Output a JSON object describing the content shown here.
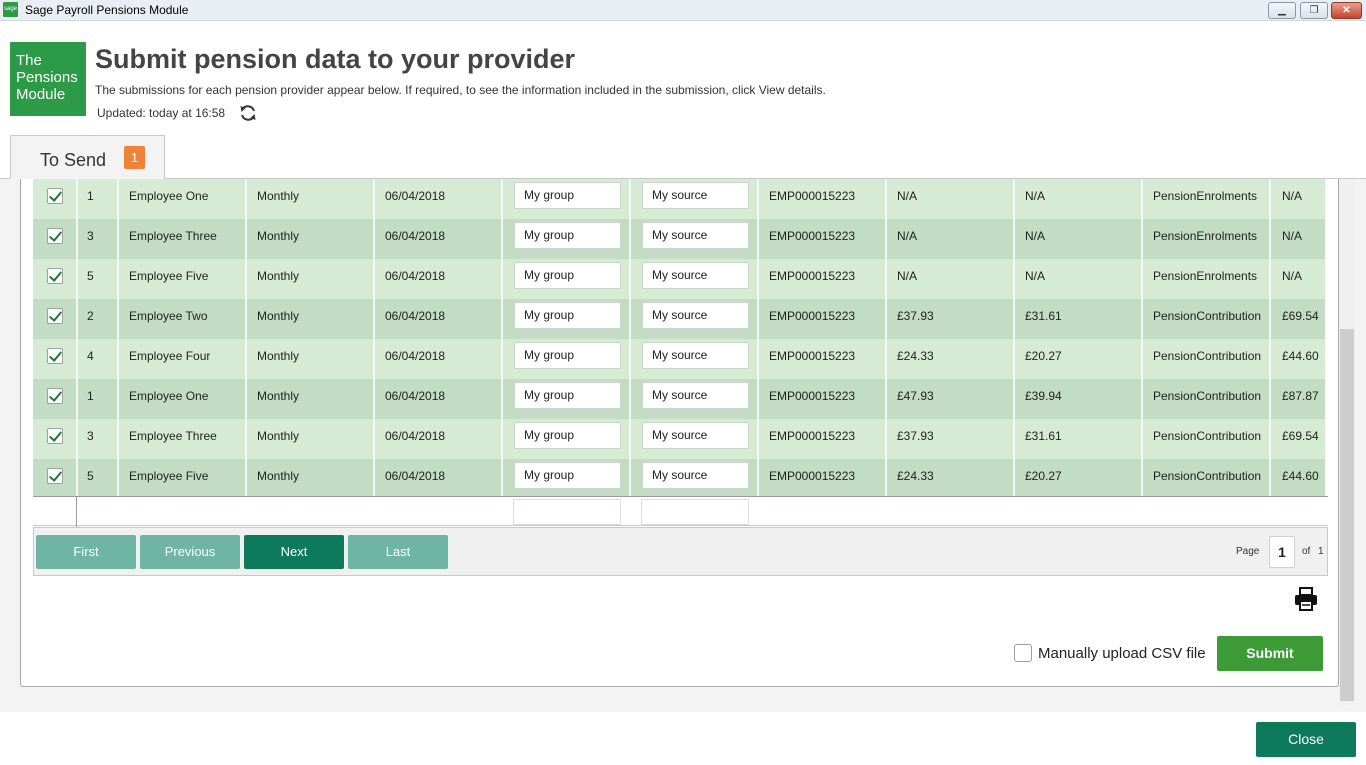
{
  "window": {
    "app_icon_text": "sage",
    "title": "Sage Payroll Pensions Module",
    "min_symbol": "▁",
    "max_symbol": "❐",
    "close_symbol": "✕"
  },
  "header": {
    "logo_lines": [
      "The",
      "Pensions",
      "Module"
    ],
    "title": "Submit pension data to your provider",
    "subtitle": "The submissions for each pension provider appear below. If required, to see the information included in the submission, click View details.",
    "updated": "Updated: today at 16:58"
  },
  "tabs": [
    {
      "label": "To Send",
      "badge": "1"
    }
  ],
  "rows": [
    {
      "checked": true,
      "num": "1",
      "name": "Employee One",
      "freq": "Monthly",
      "date": "06/04/2018",
      "group": "My group",
      "source": "My source",
      "ref": "EMP000015223",
      "c1": "N/A",
      "c2": "N/A",
      "type": "PensionEnrolments",
      "c3": "N/A"
    },
    {
      "checked": true,
      "num": "3",
      "name": "Employee Three",
      "freq": "Monthly",
      "date": "06/04/2018",
      "group": "My group",
      "source": "My source",
      "ref": "EMP000015223",
      "c1": "N/A",
      "c2": "N/A",
      "type": "PensionEnrolments",
      "c3": "N/A"
    },
    {
      "checked": true,
      "num": "5",
      "name": "Employee Five",
      "freq": "Monthly",
      "date": "06/04/2018",
      "group": "My group",
      "source": "My source",
      "ref": "EMP000015223",
      "c1": "N/A",
      "c2": "N/A",
      "type": "PensionEnrolments",
      "c3": "N/A"
    },
    {
      "checked": true,
      "num": "2",
      "name": "Employee Two",
      "freq": "Monthly",
      "date": "06/04/2018",
      "group": "My group",
      "source": "My source",
      "ref": "EMP000015223",
      "c1": "£37.93",
      "c2": "£31.61",
      "type": "PensionContribution",
      "c3": "£69.54"
    },
    {
      "checked": true,
      "num": "4",
      "name": "Employee Four",
      "freq": "Monthly",
      "date": "06/04/2018",
      "group": "My group",
      "source": "My source",
      "ref": "EMP000015223",
      "c1": "£24.33",
      "c2": "£20.27",
      "type": "PensionContribution",
      "c3": "£44.60"
    },
    {
      "checked": true,
      "num": "1",
      "name": "Employee One",
      "freq": "Monthly",
      "date": "06/04/2018",
      "group": "My group",
      "source": "My source",
      "ref": "EMP000015223",
      "c1": "£47.93",
      "c2": "£39.94",
      "type": "PensionContribution",
      "c3": "£87.87"
    },
    {
      "checked": true,
      "num": "3",
      "name": "Employee Three",
      "freq": "Monthly",
      "date": "06/04/2018",
      "group": "My group",
      "source": "My source",
      "ref": "EMP000015223",
      "c1": "£37.93",
      "c2": "£31.61",
      "type": "PensionContribution",
      "c3": "£69.54"
    },
    {
      "checked": true,
      "num": "5",
      "name": "Employee Five",
      "freq": "Monthly",
      "date": "06/04/2018",
      "group": "My group",
      "source": "My source",
      "ref": "EMP000015223",
      "c1": "£24.33",
      "c2": "£20.27",
      "type": "PensionContribution",
      "c3": "£44.60"
    }
  ],
  "pager": {
    "first": "First",
    "previous": "Previous",
    "next": "Next",
    "last": "Last",
    "page_label": "Page",
    "page_value": "1",
    "of_label": "of",
    "total_pages": "1"
  },
  "footer": {
    "csv_label": "Manually upload CSV file",
    "submit": "Submit",
    "close": "Close"
  },
  "colors": {
    "brand_green": "#2d9a48",
    "accent_teal": "#0e7a5c",
    "badge_orange": "#f0833a",
    "row_light": "#d5ebd4",
    "row_dark": "#c3dcc4"
  }
}
